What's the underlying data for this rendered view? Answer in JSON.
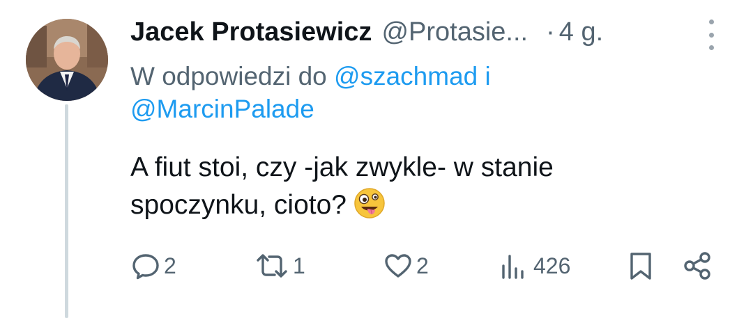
{
  "author": {
    "name": "Jacek Protasiewicz",
    "handle": "@Protasie...",
    "separator": "·",
    "time": "4 g."
  },
  "reply": {
    "prefix": "W odpowiedzi do",
    "mention1": "@szachmad",
    "conjunction": "i",
    "mention2": "@MarcinPalade"
  },
  "text": {
    "line1": "A fiut stoi, czy -jak zwykle- w stanie",
    "line2": "spoczynku, cioto?"
  },
  "emoji_name": "zany-face",
  "actions": {
    "replies": "2",
    "retweets": "1",
    "likes": "2",
    "views": "426"
  },
  "colors": {
    "text": "#0f1419",
    "secondary": "#536471",
    "link": "#1d9bf0",
    "thread_line": "#cfd9de"
  }
}
